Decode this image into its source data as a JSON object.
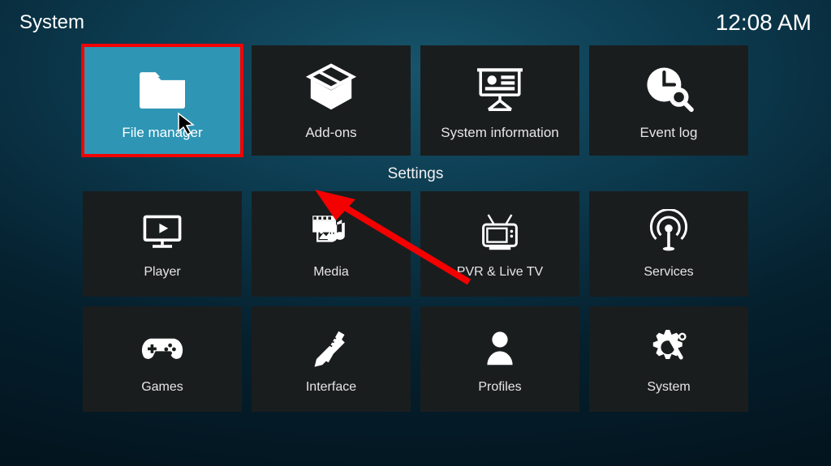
{
  "header": {
    "title": "System",
    "clock": "12:08 AM"
  },
  "section_title": "Settings",
  "tiles_top": [
    {
      "label": "File manager",
      "id": "file-manager",
      "selected": true
    },
    {
      "label": "Add-ons",
      "id": "add-ons"
    },
    {
      "label": "System information",
      "id": "system-information"
    },
    {
      "label": "Event log",
      "id": "event-log"
    }
  ],
  "tiles_mid": [
    {
      "label": "Player",
      "id": "player"
    },
    {
      "label": "Media",
      "id": "media"
    },
    {
      "label": "PVR & Live TV",
      "id": "pvr-live-tv"
    },
    {
      "label": "Services",
      "id": "services"
    }
  ],
  "tiles_bottom": [
    {
      "label": "Games",
      "id": "games"
    },
    {
      "label": "Interface",
      "id": "interface"
    },
    {
      "label": "Profiles",
      "id": "profiles"
    },
    {
      "label": "System",
      "id": "system"
    }
  ],
  "annotation": {
    "highlight_color": "#f30000",
    "accent_color": "#2e95b5"
  }
}
